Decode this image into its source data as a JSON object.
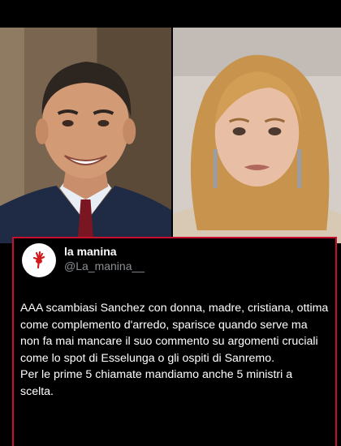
{
  "tweet": {
    "display_name": "la manina",
    "handle": "@La_manina__",
    "text": "AAA scambiasi Sanchez con donna, madre, cristiana, ottima come complemento d'arredo, sparisce quando serve ma non fa mai mancare il suo commento su argomenti cruciali come lo spot di Esselunga o gli ospiti di Sanremo.\nPer le prime 5 chiamate mandiamo anche 5 ministri a scelta."
  },
  "colors": {
    "background": "#000000",
    "card_border": "#c8102e",
    "name": "#ffffff",
    "handle": "#8b8f94"
  },
  "icons": {
    "avatar": "red-hand-icon"
  }
}
